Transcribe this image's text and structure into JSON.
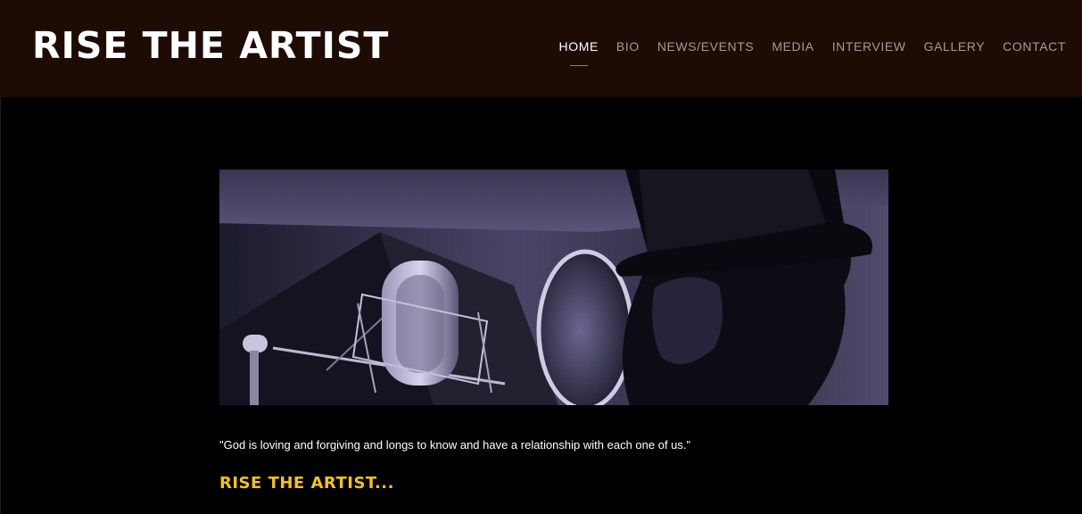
{
  "site": {
    "title": "RISE THE ARTIST",
    "header_bg": "#1e0b04",
    "body_bg": "#000000"
  },
  "nav": {
    "items": [
      {
        "label": "HOME",
        "active": true
      },
      {
        "label": "BIO",
        "active": false
      },
      {
        "label": "NEWS/EVENTS",
        "active": false
      },
      {
        "label": "MEDIA",
        "active": false
      },
      {
        "label": "INTERVIEW",
        "active": false
      },
      {
        "label": "GALLERY",
        "active": false
      },
      {
        "label": "CONTACT",
        "active": false
      }
    ]
  },
  "hero": {
    "subject": "studio-photo-artist-with-microphone"
  },
  "content": {
    "quote": "\"God is loving and forgiving and longs to know and have a relationship with each one of us.\"",
    "tagline": "RISE THE ARTIST...",
    "tagline_color": "#f3c316"
  }
}
